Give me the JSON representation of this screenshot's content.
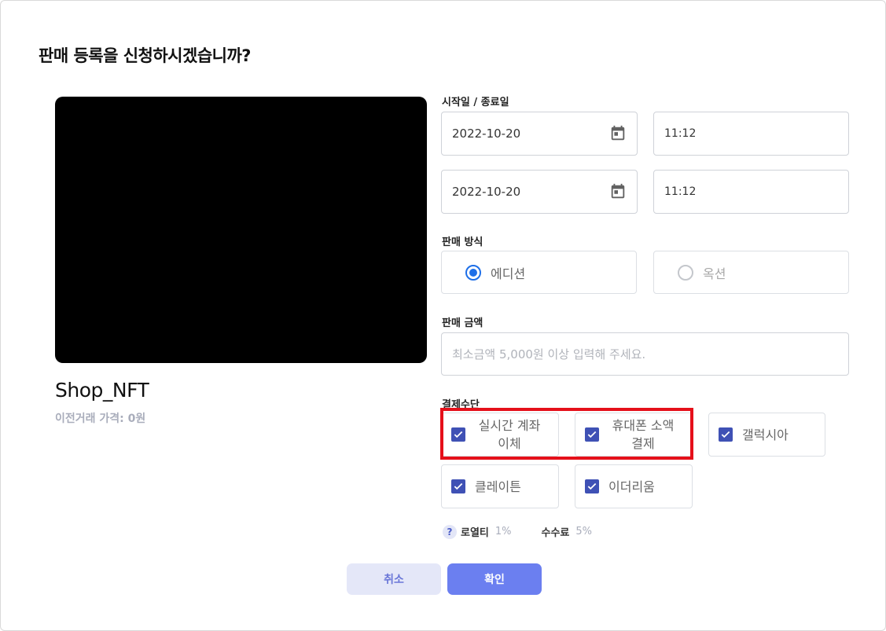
{
  "dialog": {
    "title": "판매 등록을 신청하시겠습니까?"
  },
  "nft": {
    "name": "Shop_NFT",
    "previous_price": "이전거래 가격: 0원"
  },
  "schedule": {
    "label": "시작일 / 종료일",
    "start_date": "2022-10-20",
    "start_time": "11:12",
    "end_date": "2022-10-20",
    "end_time": "11:12"
  },
  "sale_method": {
    "label": "판매 방식",
    "options": [
      {
        "label": "에디션",
        "selected": true
      },
      {
        "label": "옥션",
        "selected": false
      }
    ]
  },
  "sale_price": {
    "label": "판매 금액",
    "value": "",
    "placeholder": "최소금액 5,000원 이상 입력해 주세요."
  },
  "payment": {
    "label": "결제수단",
    "options": [
      {
        "line1": "실시간 계좌",
        "line2": "이체",
        "checked": true
      },
      {
        "line1": "휴대폰 소액",
        "line2": "결제",
        "checked": true
      },
      {
        "line1": "갤럭시아",
        "checked": true
      },
      {
        "line1": "클레이튼",
        "checked": true
      },
      {
        "line1": "이더리움",
        "checked": true
      }
    ]
  },
  "fees": {
    "help": "?",
    "royalty_label": "로열티",
    "royalty_value": "1%",
    "commission_label": "수수료",
    "commission_value": "5%"
  },
  "buttons": {
    "cancel": "취소",
    "confirm": "확인"
  },
  "colors": {
    "accent": "#6b7ff0",
    "checkbox": "#3f51b5",
    "radio": "#1e6fe8",
    "highlight": "#e5101a"
  }
}
